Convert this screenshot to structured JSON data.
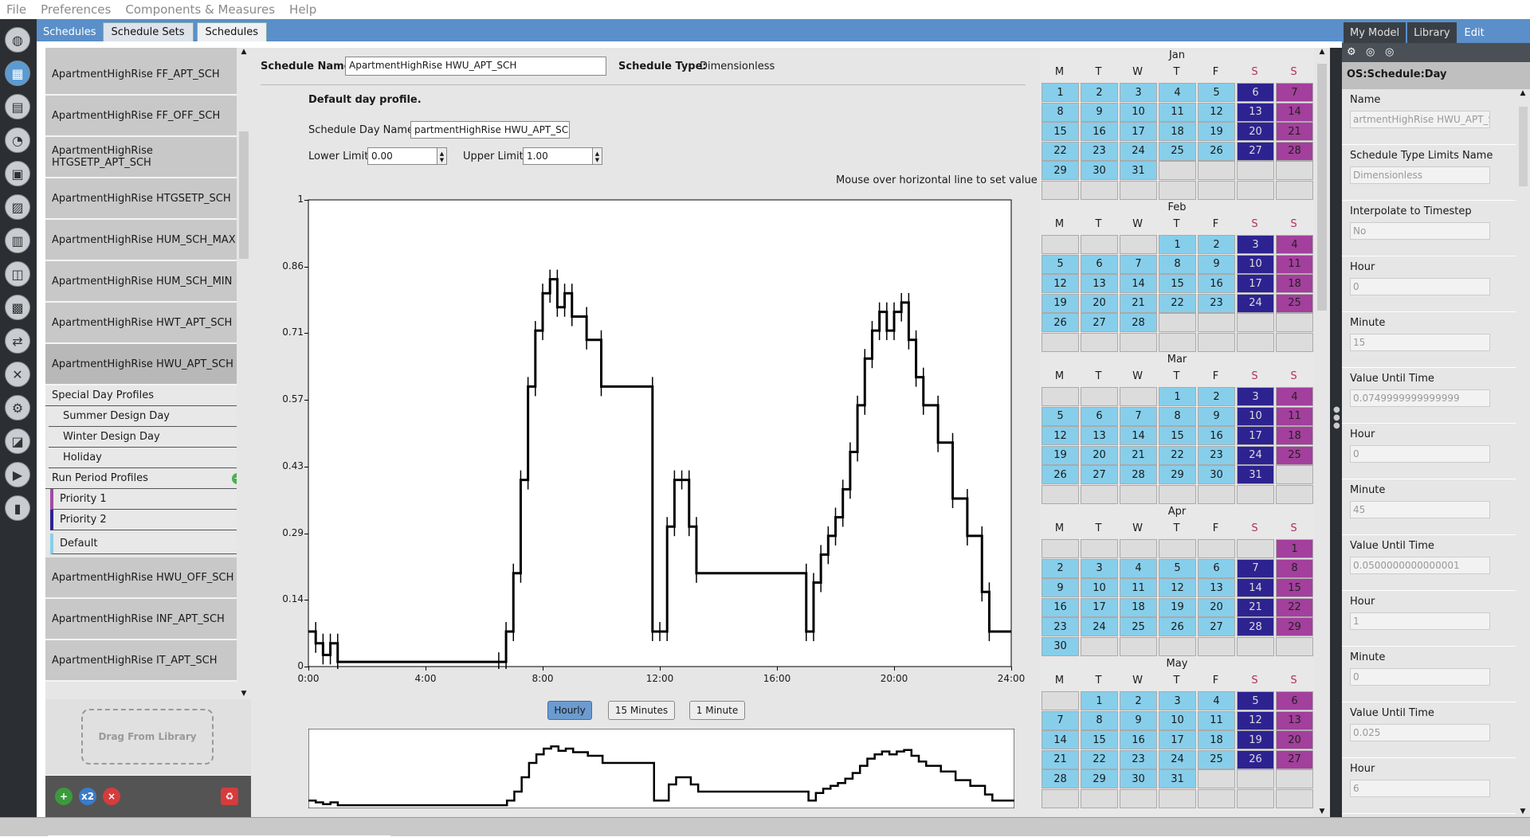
{
  "menu": [
    "File",
    "Preferences",
    "Components & Measures",
    "Help"
  ],
  "top_tabs": {
    "label": "Schedules",
    "tabs": [
      "Schedule Sets",
      "Schedules"
    ]
  },
  "list": {
    "items_before": [
      "ApartmentHighRise FF_APT_SCH",
      "ApartmentHighRise FF_OFF_SCH",
      "ApartmentHighRise HTGSETP_APT_SCH",
      "ApartmentHighRise HTGSETP_SCH",
      "ApartmentHighRise HUM_SCH_MAX",
      "ApartmentHighRise HUM_SCH_MIN",
      "ApartmentHighRise HWT_APT_SCH"
    ],
    "selected": "ApartmentHighRise HWU_APT_SCH",
    "special_day_profiles": "Special Day Profiles",
    "special_days": [
      "Summer Design Day",
      "Winter Design Day",
      "Holiday"
    ],
    "run_period_profiles": "Run Period Profiles",
    "priorities": [
      "Priority 1",
      "Priority 2"
    ],
    "default_label": "Default",
    "items_after": [
      "ApartmentHighRise HWU_OFF_SCH",
      "ApartmentHighRise INF_APT_SCH",
      "ApartmentHighRise IT_APT_SCH"
    ],
    "drag_text": "Drag From Library",
    "x2_label": "x2"
  },
  "editor": {
    "schedule_name_label": "Schedule Name:",
    "schedule_name": "ApartmentHighRise HWU_APT_SCH",
    "schedule_type_label": "Schedule Type:",
    "schedule_type": "Dimensionless",
    "profile_title": "Default day profile.",
    "day_name_label": "Schedule Day Name:",
    "day_name": "partmentHighRise HWU_APT_SCH",
    "lower_label": "Lower Limit:",
    "lower_value": "0.00",
    "upper_label": "Upper Limit:",
    "upper_value": "1.00",
    "hint": "Mouse over horizontal line to set value",
    "buttons": [
      "Hourly",
      "15 Minutes",
      "1 Minute"
    ]
  },
  "chart_data": {
    "type": "line",
    "title": "",
    "xlabel": "",
    "ylabel": "",
    "x_ticks": [
      "0:00",
      "4:00",
      "8:00",
      "12:00",
      "16:00",
      "20:00",
      "24:00"
    ],
    "y_ticks": [
      "0",
      "0.14",
      "0.29",
      "0.43",
      "0.57",
      "0.71",
      "0.86",
      "1"
    ],
    "xlim": [
      0,
      24
    ],
    "ylim": [
      0,
      1
    ],
    "step_hours": [
      0,
      0.25,
      0.5,
      0.75,
      1,
      6.5,
      6.75,
      7,
      7.25,
      7.5,
      7.75,
      8,
      8.25,
      8.5,
      8.75,
      9,
      9.5,
      10,
      11.75,
      12,
      12.25,
      12.5,
      12.75,
      13,
      13.25,
      17,
      17.25,
      17.5,
      17.75,
      18,
      18.25,
      18.5,
      18.75,
      19,
      19.25,
      19.5,
      19.75,
      20,
      20.25,
      20.5,
      20.75,
      21,
      21.5,
      22,
      22.5,
      23,
      23.25,
      24
    ],
    "values": [
      0.075,
      0.05,
      0.025,
      0.05,
      0.01,
      0.01,
      0.075,
      0.2,
      0.4,
      0.6,
      0.72,
      0.8,
      0.83,
      0.77,
      0.8,
      0.75,
      0.7,
      0.6,
      0.075,
      0.075,
      0.3,
      0.4,
      0.4,
      0.3,
      0.2,
      0.075,
      0.18,
      0.24,
      0.28,
      0.32,
      0.38,
      0.46,
      0.56,
      0.66,
      0.72,
      0.76,
      0.72,
      0.76,
      0.78,
      0.7,
      0.62,
      0.56,
      0.48,
      0.36,
      0.28,
      0.16,
      0.075,
      0.075
    ]
  },
  "calendar": {
    "dow": [
      "M",
      "T",
      "W",
      "T",
      "F",
      "S",
      "S"
    ],
    "months": [
      {
        "name": "Jan",
        "offset": 0,
        "days": 31
      },
      {
        "name": "Feb",
        "offset": 3,
        "days": 28
      },
      {
        "name": "Mar",
        "offset": 3,
        "days": 31
      },
      {
        "name": "Apr",
        "offset": 6,
        "days": 30
      },
      {
        "name": "May",
        "offset": 1,
        "days": 31
      }
    ],
    "colors": {
      "weekday": "#87ceeb",
      "saturday": "#2d2390",
      "sunday": "#a33f9c",
      "empty": "#dcdcdc"
    }
  },
  "right": {
    "tabs": [
      "My Model",
      "Library",
      "Edit"
    ],
    "header": "OS:Schedule:Day",
    "fields": [
      {
        "label": "Name",
        "value": "artmentHighRise HWU_APT_SCH"
      },
      {
        "label": "Schedule Type Limits Name",
        "value": "Dimensionless"
      },
      {
        "label": "Interpolate to Timestep",
        "value": "No"
      },
      {
        "label": "Hour",
        "value": "0"
      },
      {
        "label": "Minute",
        "value": "15"
      },
      {
        "label": "Value Until Time",
        "value": "0.0749999999999999"
      },
      {
        "label": "Hour",
        "value": "0"
      },
      {
        "label": "Minute",
        "value": "45"
      },
      {
        "label": "Value Until Time",
        "value": "0.0500000000000001"
      },
      {
        "label": "Hour",
        "value": "1"
      },
      {
        "label": "Minute",
        "value": "0"
      },
      {
        "label": "Value Until Time",
        "value": "0.025"
      },
      {
        "label": "Hour",
        "value": "6"
      }
    ]
  }
}
